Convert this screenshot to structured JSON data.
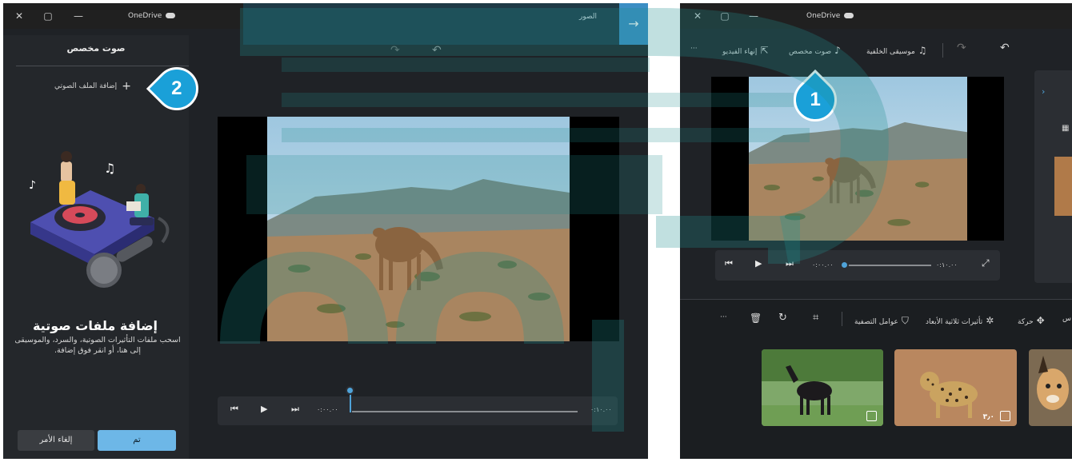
{
  "left_window": {
    "title": "OneDrive",
    "photos_label": "الصور",
    "panel": {
      "title": "صوت مخصص",
      "add_audio": "إضافة الملف الصوتي",
      "empty_heading": "إضافة ملفات صوتية",
      "empty_desc": "اسحب ملفات التأثيرات الصوتية، والسرد، والموسيقى إلى هنا، أو انقر فوق إضافة.",
      "done_button": "تم",
      "cancel_button": "إلغاء الأمر"
    },
    "player": {
      "time_start": "٠:٠٠.٠٠",
      "time_end": "٠:١٠.٠٠",
      "progress": 0.0
    }
  },
  "right_window": {
    "title": "OneDrive",
    "toolbar": {
      "background_music": "موسيقى الخلفية",
      "custom_audio": "صوت مخصص",
      "finish_video": "إنهاء الفيديو",
      "more": "···"
    },
    "player": {
      "time_start": "٠:٠٠.٠٠",
      "time_end": "٠:١٠.٠٠",
      "progress": 0.0
    },
    "storyboard_toolbar": {
      "motion": "حركة",
      "effects_3d": "تأثيرات ثلاثية الأبعاد",
      "filters": "عوامل التصفية",
      "partial_label": "س",
      "more": "···"
    },
    "thumbnails": [
      {
        "subject": "horse",
        "duration": ""
      },
      {
        "subject": "leopard",
        "duration": "٣٫٠"
      },
      {
        "subject": "lynx",
        "duration": ""
      }
    ]
  },
  "callouts": [
    "1",
    "2"
  ],
  "colors": {
    "accent": "#1aa0d8",
    "button_primary": "#6db7e7",
    "app_bg": "#1f2226"
  },
  "icons": [
    "close-icon",
    "maximize-icon",
    "minimize-icon",
    "cloud-icon",
    "plus-icon",
    "play-icon",
    "previous-frame-icon",
    "next-frame-icon",
    "undo-icon",
    "redo-icon",
    "music-icon",
    "custom-audio-icon",
    "export-icon",
    "expand-icon",
    "delete-icon",
    "rotate-icon",
    "crop-icon",
    "filter-icon",
    "effects-icon",
    "motion-icon",
    "image-icon"
  ]
}
